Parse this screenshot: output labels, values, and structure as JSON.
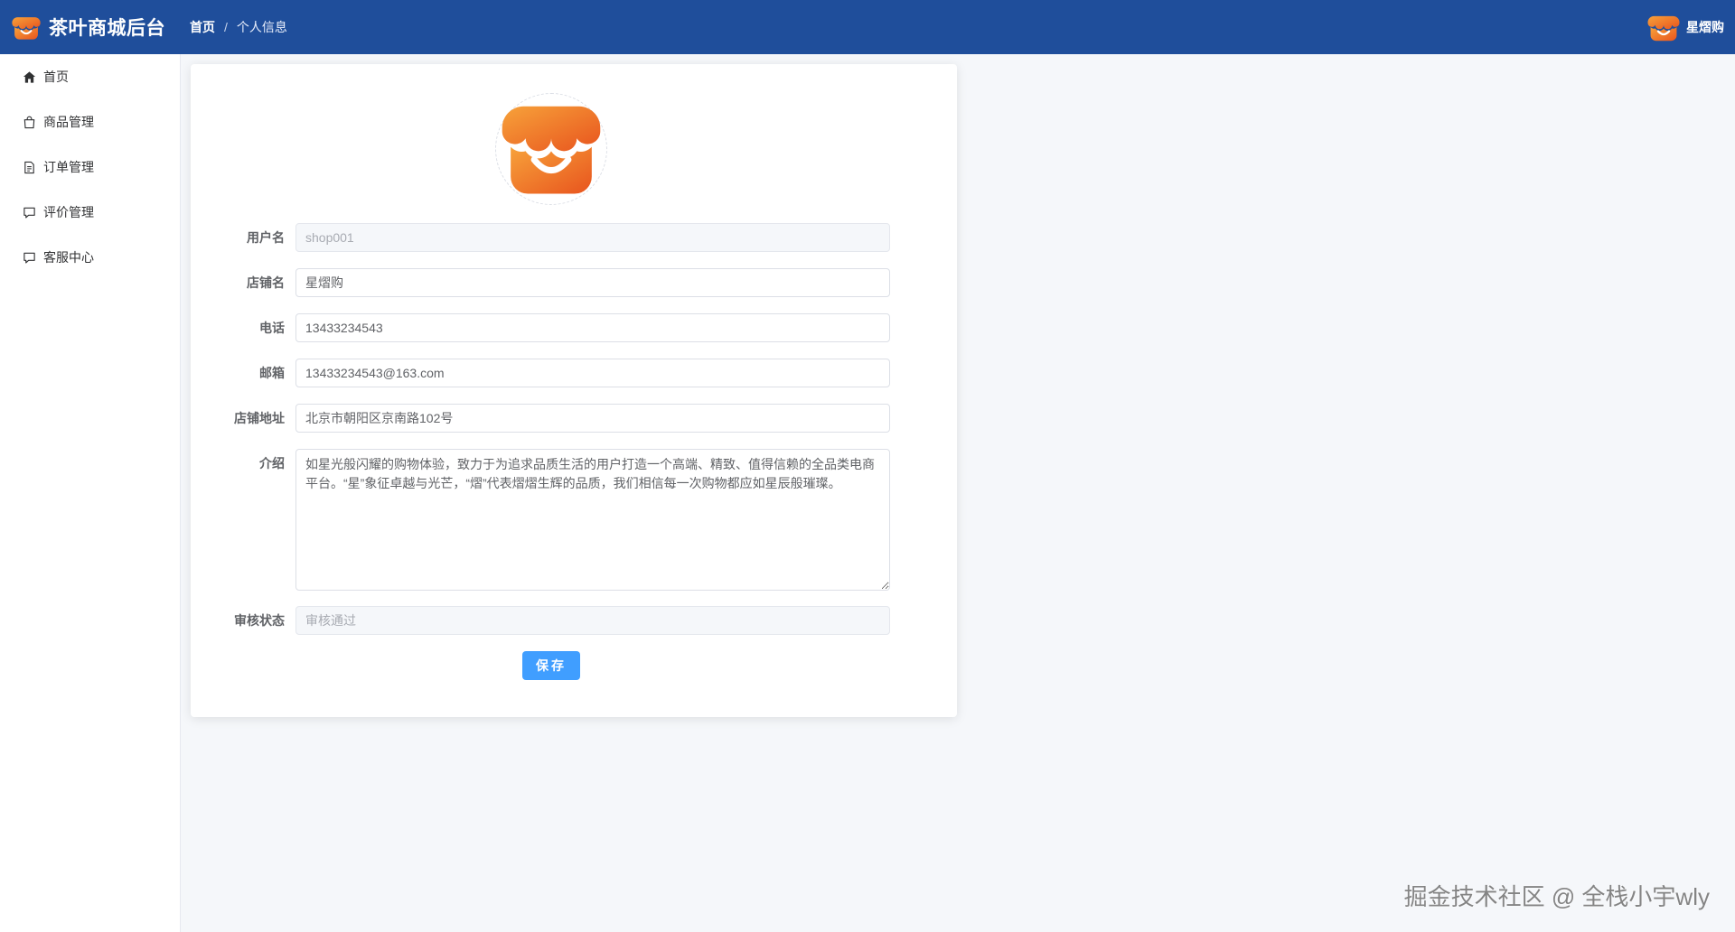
{
  "header": {
    "brand_title": "茶叶商城后台",
    "breadcrumb": [
      "首页",
      "个人信息"
    ],
    "breadcrumb_sep": "/",
    "user_name": "星熠购",
    "bg_color": "#1f4e9b"
  },
  "sidebar": {
    "items": [
      {
        "label": "首页",
        "icon": "home-icon"
      },
      {
        "label": "商品管理",
        "icon": "shopping-bag-icon"
      },
      {
        "label": "订单管理",
        "icon": "document-icon"
      },
      {
        "label": "评价管理",
        "icon": "comment-icon"
      },
      {
        "label": "客服中心",
        "icon": "chat-icon"
      }
    ]
  },
  "profile_form": {
    "avatar_icon": "store-logo-icon",
    "fields": {
      "username": {
        "label": "用户名",
        "value": "shop001",
        "disabled": true
      },
      "shop_name": {
        "label": "店铺名",
        "value": "星熠购"
      },
      "phone": {
        "label": "电话",
        "value": "13433234543"
      },
      "email": {
        "label": "邮箱",
        "value": "13433234543@163.com"
      },
      "address": {
        "label": "店铺地址",
        "value": "北京市朝阳区京南路102号"
      },
      "intro": {
        "label": "介绍",
        "value": "如星光般闪耀的购物体验，致力于为追求品质生活的用户打造一个高端、精致、值得信赖的全品类电商平台。“星”象征卓越与光芒，“熠”代表熠熠生辉的品质，我们相信每一次购物都应如星辰般璀璨。"
      },
      "audit_status": {
        "label": "审核状态",
        "value": "审核通过",
        "disabled": true
      }
    },
    "save_label": "保存",
    "primary_color": "#409eff"
  },
  "watermark": "掘金技术社区 @ 全栈小宇wly"
}
